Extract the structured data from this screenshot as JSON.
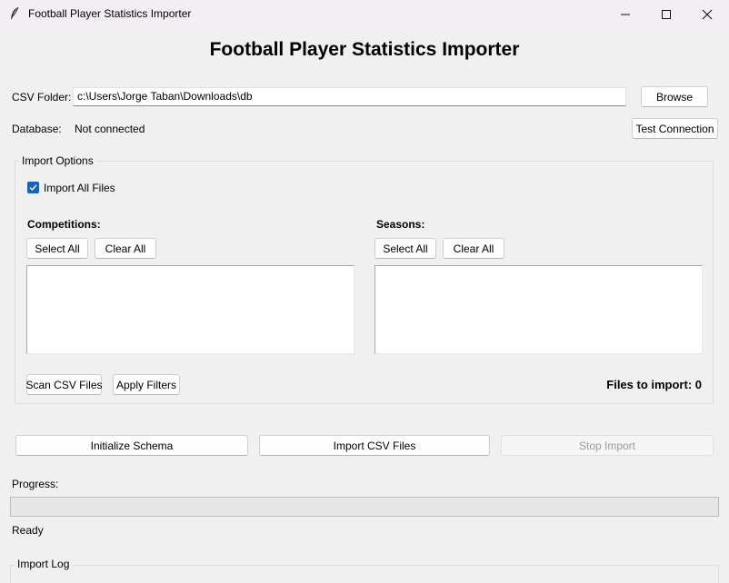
{
  "window": {
    "title": "Football Player Statistics Importer"
  },
  "header": {
    "title": "Football Player Statistics Importer"
  },
  "csv": {
    "label": "CSV Folder:",
    "path": "c:\\Users\\Jorge Taban\\Downloads\\db",
    "browse_label": "Browse"
  },
  "database": {
    "label": "Database:",
    "status": "Not connected",
    "test_label": "Test Connection"
  },
  "import_options": {
    "legend": "Import Options",
    "import_all_label": "Import All Files",
    "import_all_checked": true,
    "competitions": {
      "label": "Competitions:",
      "select_all": "Select All",
      "clear_all": "Clear All",
      "items": []
    },
    "seasons": {
      "label": "Seasons:",
      "select_all": "Select All",
      "clear_all": "Clear All",
      "items": []
    },
    "scan_label": "Scan CSV Files",
    "apply_label": "Apply Filters",
    "files_to_import": "Files to import: 0"
  },
  "actions": {
    "init_schema": "Initialize Schema",
    "import_csv": "Import CSV Files",
    "stop_import": "Stop Import",
    "stop_enabled": false
  },
  "progress": {
    "label": "Progress:",
    "value": 0,
    "status": "Ready"
  },
  "log": {
    "legend": "Import Log"
  },
  "colors": {
    "accent": "#1a62b6",
    "window_bg": "#f0f0f0",
    "titlebar_bg": "#f3eef4"
  }
}
